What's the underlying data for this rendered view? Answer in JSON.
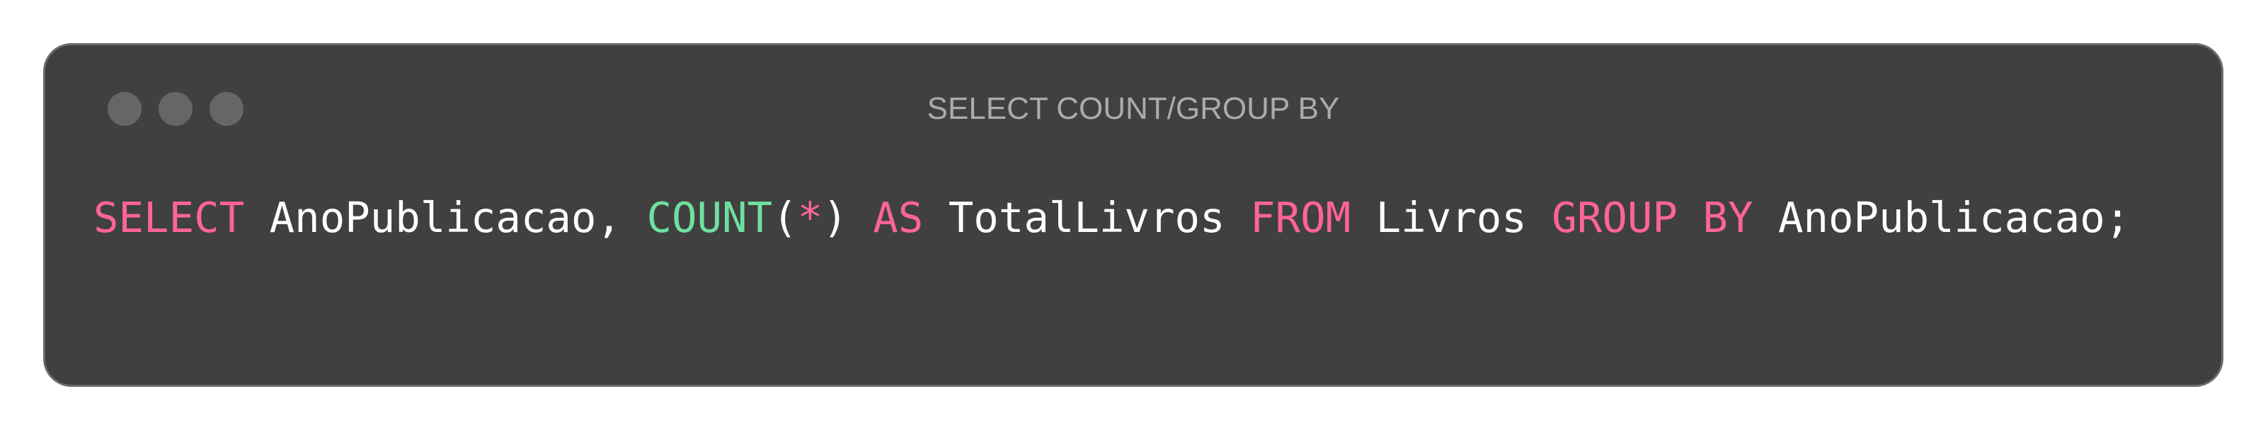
{
  "window": {
    "title": "SELECT COUNT/GROUP BY",
    "controls": [
      "close",
      "minimize",
      "maximize"
    ]
  },
  "colors": {
    "keyword": "#ff6496",
    "function": "#6ee0a0",
    "text": "#ffffff",
    "background": "#404040"
  },
  "code": {
    "tokens": [
      {
        "text": "SELECT",
        "type": "kw"
      },
      {
        "text": " AnoPublicacao, ",
        "type": "id"
      },
      {
        "text": "COUNT",
        "type": "fn"
      },
      {
        "text": "(",
        "type": "id"
      },
      {
        "text": "*",
        "type": "kw"
      },
      {
        "text": ") ",
        "type": "id"
      },
      {
        "text": "AS",
        "type": "kw"
      },
      {
        "text": " TotalLivros ",
        "type": "id"
      },
      {
        "text": "FROM",
        "type": "kw"
      },
      {
        "text": " Livros ",
        "type": "id"
      },
      {
        "text": "GROUP BY",
        "type": "kw"
      },
      {
        "text": " AnoPublicacao;",
        "type": "id"
      }
    ]
  }
}
